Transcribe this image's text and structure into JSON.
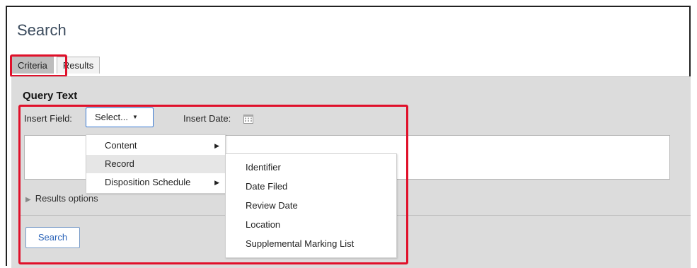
{
  "page": {
    "title": "Search"
  },
  "tabs": [
    {
      "label": "Criteria",
      "active": true
    },
    {
      "label": "Results",
      "active": false
    }
  ],
  "query": {
    "section_label": "Query Text",
    "insert_field_label": "Insert Field:",
    "select_value": "Select...",
    "insert_date_label": "Insert Date:",
    "text_value": ""
  },
  "field_menu": {
    "items": [
      {
        "label": "Content",
        "has_submenu": true
      },
      {
        "label": "Record",
        "has_submenu": false,
        "highlighted": true
      },
      {
        "label": "Disposition Schedule",
        "has_submenu": true
      }
    ]
  },
  "record_submenu": {
    "items": [
      {
        "label": "Identifier"
      },
      {
        "label": "Date Filed"
      },
      {
        "label": "Review Date"
      },
      {
        "label": "Location"
      },
      {
        "label": "Supplemental Marking List"
      }
    ]
  },
  "results_options": {
    "label": "Results options"
  },
  "actions": {
    "search_label": "Search"
  },
  "colors": {
    "highlight": "#e0102a",
    "link_blue": "#2a63b8",
    "panel_gray": "#dcdcdc"
  },
  "icons": {
    "calendar": "calendar-icon",
    "dropdown": "caret-down-icon",
    "submenu": "caret-right-icon",
    "expand": "triangle-right-icon"
  }
}
